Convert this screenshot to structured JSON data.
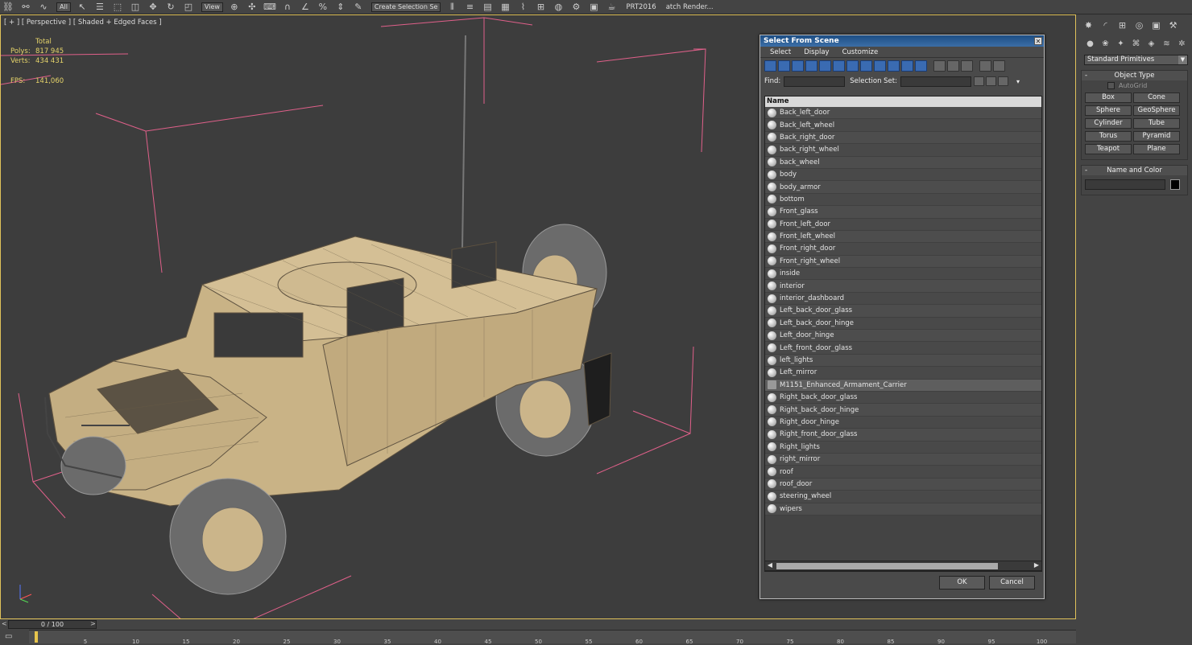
{
  "toolbar": {
    "filter_value": "All",
    "refcoord_value": "View",
    "selection_set_value": "Create Selection Se",
    "prt_label": "PRT2016",
    "batch_render_label": "atch Render..."
  },
  "viewport": {
    "label": "[ + ] [ Perspective ] [ Shaded + Edged Faces ]",
    "stats": {
      "total_label": "Total",
      "polys_label": "Polys:",
      "polys_value": "817 945",
      "verts_label": "Verts:",
      "verts_value": "434 431",
      "fps_label": "FPS:",
      "fps_value": "141,060"
    }
  },
  "dialog": {
    "title": "Select From Scene",
    "menu": [
      "Select",
      "Display",
      "Customize"
    ],
    "find_label": "Find:",
    "find_value": "",
    "selection_set_label": "Selection Set:",
    "selection_set_value": "",
    "column_header": "Name",
    "items": [
      "Back_left_door",
      "Back_left_wheel",
      "Back_right_door",
      "back_right_wheel",
      "back_wheel",
      "body",
      "body_armor",
      "bottom",
      "Front_glass",
      "Front_left_door",
      "Front_left_wheel",
      "Front_right_door",
      "Front_right_wheel",
      "inside",
      "interior",
      "interior_dashboard",
      "Left_back_door_glass",
      "Left_back_door_hinge",
      "Left_door_hinge",
      "Left_front_door_glass",
      "left_lights",
      "Left_mirror",
      "M1151_Enhanced_Armament_Carrier",
      "Right_back_door_glass",
      "Right_back_door_hinge",
      "Right_door_hinge",
      "Right_front_door_glass",
      "Right_lights",
      "right_mirror",
      "roof",
      "roof_door",
      "steering_wheel",
      "wipers"
    ],
    "selected_item": "M1151_Enhanced_Armament_Carrier",
    "ok_label": "OK",
    "cancel_label": "Cancel"
  },
  "command_panel": {
    "category_value": "Standard Primitives",
    "object_type_title": "Object Type",
    "autogrid_label": "AutoGrid",
    "buttons": [
      "Box",
      "Cone",
      "Sphere",
      "GeoSphere",
      "Cylinder",
      "Tube",
      "Torus",
      "Pyramid",
      "Teapot",
      "Plane"
    ],
    "name_color_title": "Name and Color",
    "name_value": "",
    "object_color": "#000000"
  },
  "timeline": {
    "slider_value": "0 / 100",
    "ticks": [
      "5",
      "10",
      "15",
      "20",
      "25",
      "30",
      "35",
      "40",
      "45",
      "50",
      "55",
      "60",
      "65",
      "70",
      "75",
      "80",
      "85",
      "90",
      "95",
      "100"
    ]
  },
  "colors": {
    "accent_border": "#e0c25a",
    "stats_text": "#e6d46a",
    "bounding_box": "#e0608a",
    "vehicle": "#cbb58a",
    "dialog_title": "#2b5b95"
  }
}
